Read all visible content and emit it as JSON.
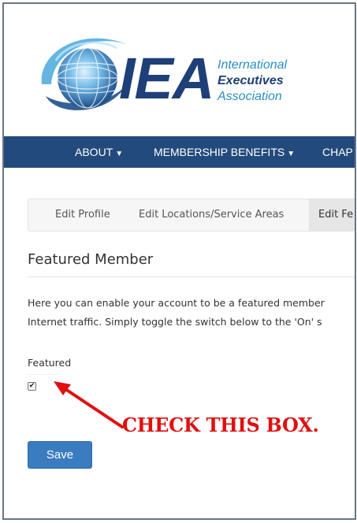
{
  "logo": {
    "abbr": "IEA",
    "line1": "International",
    "line2": "Executives",
    "line3": "Association"
  },
  "nav": {
    "items": [
      {
        "label": "ABOUT",
        "has_dropdown": true
      },
      {
        "label": "MEMBERSHIP BENEFITS",
        "has_dropdown": true
      },
      {
        "label": "CHAP",
        "has_dropdown": false
      }
    ],
    "caret": "▼"
  },
  "tabs": [
    {
      "label": "Edit Profile",
      "active": false
    },
    {
      "label": "Edit Locations/Service Areas",
      "active": false
    },
    {
      "label": "Edit Fe",
      "active": true
    }
  ],
  "section": {
    "title": "Featured Member",
    "description_line1": "Here you can enable your account to be a featured member",
    "description_line2": "Internet traffic. Simply toggle the switch below to the 'On' s"
  },
  "featured_field": {
    "label": "Featured",
    "checked": true,
    "check_glyph": "✔"
  },
  "annotation": {
    "text": "CHECK THIS BOX.",
    "color": "#e01010"
  },
  "save_label": "Save",
  "colors": {
    "nav_bg": "#234a7c",
    "button_bg": "#3b7cc0",
    "brand_dark": "#1e3f78",
    "brand_light": "#2a8fc4"
  }
}
